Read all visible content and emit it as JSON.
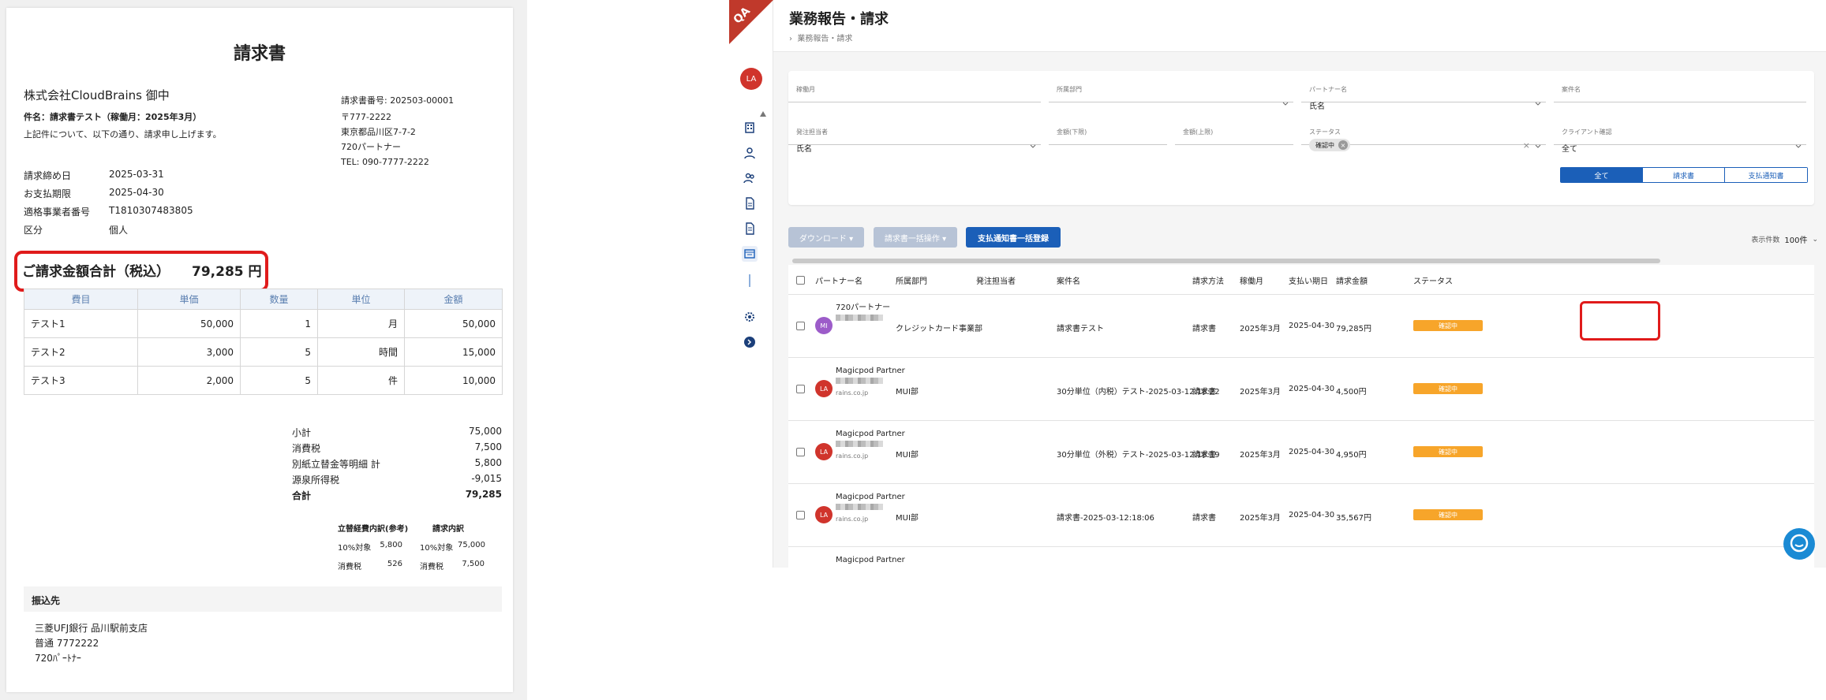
{
  "invoice": {
    "title": "請求書",
    "client": "株式会社CloudBrains 御中",
    "subject": "件名：請求書テスト（稼働月：2025年3月）",
    "intro": "上記件について、以下の通り、請求申し上げます。",
    "meta": [
      {
        "label": "請求締め日",
        "value": "2025-03-31"
      },
      {
        "label": "お支払期限",
        "value": "2025-04-30"
      },
      {
        "label": "適格事業者番号",
        "value": "T1810307483805"
      },
      {
        "label": "区分",
        "value": "個人"
      }
    ],
    "issuer": {
      "number": "請求書番号: 202503-00001",
      "postal": "〒777-2222",
      "address": "東京都品川区7-7-2",
      "name": "720パートナー",
      "tel": "TEL: 090-7777-2222"
    },
    "total_label": "ご請求金額合計（税込）",
    "total_value": "79,285 円",
    "items_headers": [
      "費目",
      "単価",
      "数量",
      "単位",
      "金額"
    ],
    "items": [
      [
        "テスト1",
        "50,000",
        "1",
        "月",
        "50,000"
      ],
      [
        "テスト2",
        "3,000",
        "5",
        "時間",
        "15,000"
      ],
      [
        "テスト3",
        "2,000",
        "5",
        "件",
        "10,000"
      ]
    ],
    "summary": [
      {
        "label": "小計",
        "value": "75,000"
      },
      {
        "label": "消費税",
        "value": "7,500"
      },
      {
        "label": "別紙立替金等明細 計",
        "value": "5,800"
      },
      {
        "label": "源泉所得税",
        "value": "-9,015"
      },
      {
        "label": "合計",
        "value": "79,285"
      }
    ],
    "breakdown": {
      "head_left": "立替経費内訳(参考)",
      "head_right": "請求内訳",
      "rows": [
        [
          "10%対象",
          "5,800",
          "10%対象",
          "75,000"
        ],
        [
          "消費税",
          "526",
          "消費税",
          "7,500"
        ]
      ]
    },
    "bank_head": "振込先",
    "bank_lines": [
      "三菱UFJ銀行 品川駅前支店",
      "普通 7772222",
      "720ﾊﾟｰﾄﾅｰ"
    ]
  },
  "app": {
    "corner_badge": "QA",
    "user_initials": "LA",
    "page_title": "業務報告・請求",
    "breadcrumb": "業務報告・請求",
    "filters": {
      "work_month": {
        "label": "稼働月",
        "value": ""
      },
      "department": {
        "label": "所属部門",
        "value": ""
      },
      "partner_name": {
        "label": "パートナー名",
        "value": "氏名"
      },
      "project_name": {
        "label": "案件名",
        "value": ""
      },
      "orderer": {
        "label": "発注担当者",
        "value": "氏名"
      },
      "amount_min": {
        "label": "金額(下限)",
        "value": ""
      },
      "amount_max": {
        "label": "金額(上限)",
        "value": ""
      },
      "status": {
        "label": "ステータス",
        "chip": "確認中"
      },
      "client_check": {
        "label": "クライアント確認",
        "value": "全て"
      }
    },
    "segments": [
      "全て",
      "請求書",
      "支払通知書"
    ],
    "toolbar": {
      "download": "ダウンロード ▾",
      "bulk": "請求書一括操作 ▾",
      "register": "支払通知書一括登録",
      "per_page_label": "表示件数",
      "per_page_value": "100件"
    },
    "columns": [
      "パートナー名",
      "所属部門",
      "発注担当者",
      "案件名",
      "請求方法",
      "稼働月",
      "支払い期日",
      "請求金額",
      "ステータス"
    ],
    "rows": [
      {
        "initials": "MI",
        "avatar_color": "#9c5cc9",
        "partner": "720パートナー",
        "sub": "",
        "dept": "クレジットカード事業部",
        "project": "請求書テスト",
        "method": "請求書",
        "month": "2025年3月",
        "due": "2025-04-30",
        "amount": "79,285円",
        "status": "確認中"
      },
      {
        "initials": "LA",
        "avatar_color": "#d0342c",
        "partner": "Magicpod Partner",
        "sub": "rains.co.jp",
        "dept": "MUI部",
        "project": "30分単位（内税）テスト-2025-03-12:18:22",
        "method": "請求書",
        "month": "2025年3月",
        "due": "2025-04-30",
        "amount": "4,500円",
        "status": "確認中"
      },
      {
        "initials": "LA",
        "avatar_color": "#d0342c",
        "partner": "Magicpod Partner",
        "sub": "rains.co.jp",
        "dept": "MUI部",
        "project": "30分単位（外税）テスト-2025-03-12:18:19",
        "method": "請求書",
        "month": "2025年3月",
        "due": "2025-04-30",
        "amount": "4,950円",
        "status": "確認中"
      },
      {
        "initials": "LA",
        "avatar_color": "#d0342c",
        "partner": "Magicpod Partner",
        "sub": "rains.co.jp",
        "dept": "MUI部",
        "project": "請求書-2025-03-12:18:06",
        "method": "請求書",
        "month": "2025年3月",
        "due": "2025-04-30",
        "amount": "35,567円",
        "status": "確認中"
      }
    ],
    "partial_row_partner": "Magicpod Partner",
    "colors": {
      "accent": "#1b5fb8",
      "status": "#f7a52a",
      "highlight": "#e01b1b"
    }
  }
}
